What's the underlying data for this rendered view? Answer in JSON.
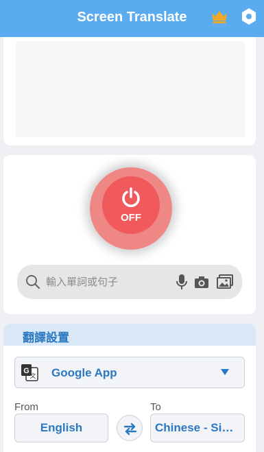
{
  "app": {
    "title": "Screen Translate"
  },
  "header": {
    "premium_icon": "crown-icon",
    "settings_icon": "gear-icon"
  },
  "power": {
    "state_label": "OFF",
    "icon": "power-icon",
    "color": "#f05a5c"
  },
  "search": {
    "placeholder": "輸入單詞或句子",
    "icons": [
      "search-icon",
      "microphone-icon",
      "camera-icon",
      "image-icon"
    ]
  },
  "settings_section": {
    "title": "翻譯設置",
    "engine": {
      "icon": "google-translate-icon",
      "selected": "Google App"
    },
    "from_label": "From",
    "to_label": "To",
    "source_language": "English",
    "target_language": "Chinese - Sim...",
    "swap_icon": "swap-icon"
  },
  "colors": {
    "header_bg": "#5aabf0",
    "accent": "#2b78c2",
    "crown": "#f5a623"
  }
}
